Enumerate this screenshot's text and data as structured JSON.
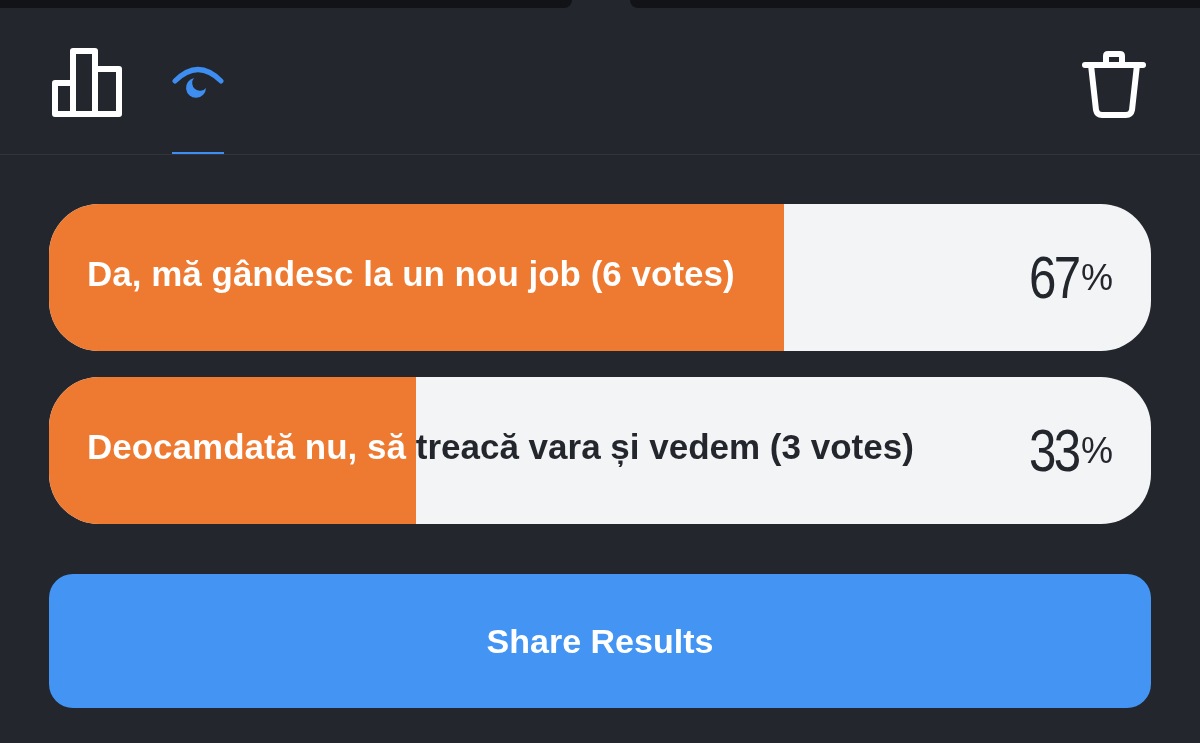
{
  "toolbar": {
    "tabs": [
      {
        "kind": "chart",
        "selected": false
      },
      {
        "kind": "eye",
        "selected": true
      }
    ]
  },
  "options": [
    {
      "label": "Da, mă gândesc la un nou job (6 votes)",
      "level": 0.667,
      "percent": "67",
      "unit": "%"
    },
    {
      "label": "Deocamdată nu, să treacă vara și vedem (3 votes)",
      "level": 0.333,
      "percent": "33",
      "unit": "%"
    }
  ],
  "share_button": "Share Results"
}
